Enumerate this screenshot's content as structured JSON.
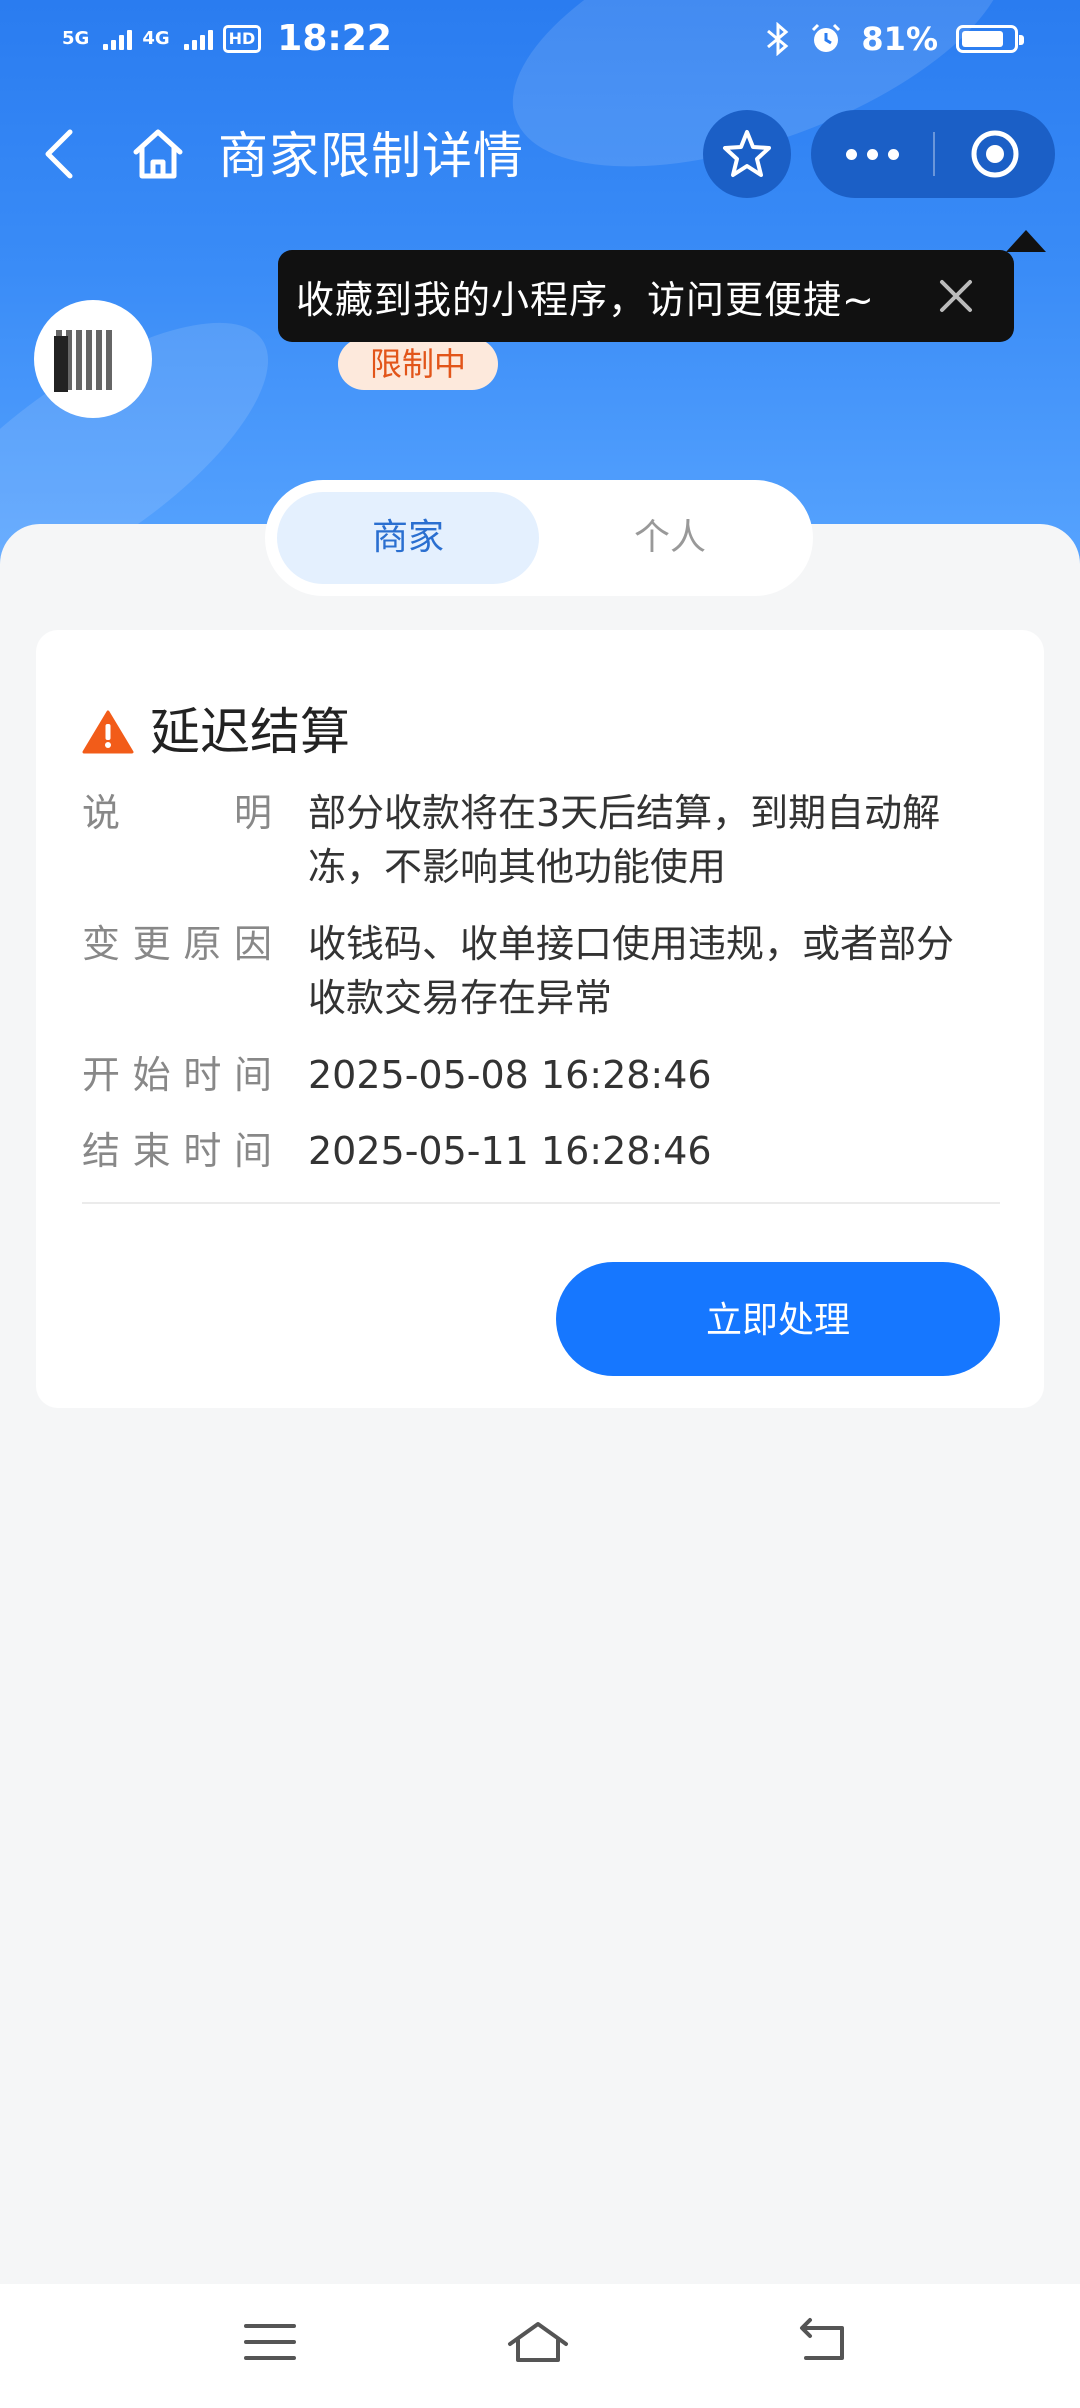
{
  "status_bar": {
    "sim1": "5G",
    "sim2": "4G",
    "hd": "HD",
    "time": "18:22",
    "battery": "81%",
    "battery_level": 0.81
  },
  "nav": {
    "title": "商家限制详情"
  },
  "tooltip": {
    "text": "收藏到我的小程序，访问更便捷~"
  },
  "merchant": {
    "status_badge": "限制中"
  },
  "tabs": [
    {
      "label": "商家",
      "active": true
    },
    {
      "label": "个人",
      "active": false
    }
  ],
  "card": {
    "title": "延迟结算",
    "rows": [
      {
        "label": "说明",
        "value": "部分收款将在3天后结算，到期自动解冻，不影响其他功能使用"
      },
      {
        "label": "变更原因",
        "value": "收钱码、收单接口使用违规，或者部分收款交易存在异常"
      },
      {
        "label": "开始时间",
        "value": "2025-05-08 16:28:46"
      },
      {
        "label": "结束时间",
        "value": "2025-05-11 16:28:46"
      }
    ],
    "action_label": "立即处理"
  },
  "colors": {
    "primary": "#1677ff",
    "header": "#2a7cf0",
    "warning": "#f25c19",
    "badge_text": "#e2551a"
  },
  "icons": [
    "back-icon",
    "home-icon",
    "star-icon",
    "more-icon",
    "target-icon",
    "close-icon",
    "warning-icon",
    "menu-icon",
    "back-arrow-icon"
  ]
}
